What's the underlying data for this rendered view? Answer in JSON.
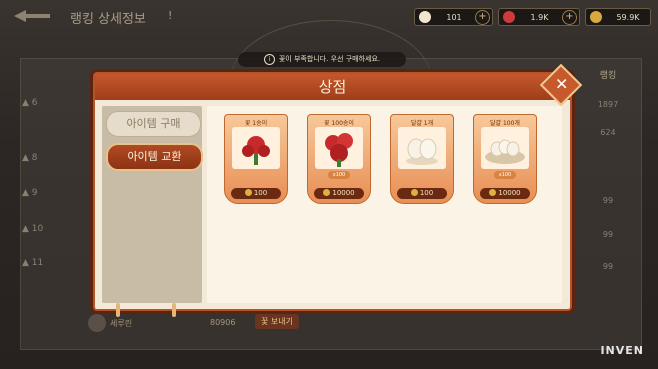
{
  "page": {
    "title": "랭킹 상세정보",
    "info_icon": "!"
  },
  "resources": [
    {
      "name": "egg",
      "value": "101",
      "color": "#f2e6cf"
    },
    {
      "name": "flower",
      "value": "1.9K",
      "color": "#d03a3a"
    },
    {
      "name": "gold",
      "value": "59.9K",
      "color": "#d9a840"
    }
  ],
  "notice": "꽃이 부족합니다. 우선 구매하세요.",
  "modal": {
    "title": "상점",
    "close_icon": "close-icon"
  },
  "tabs": [
    {
      "label": "아이템 구매",
      "active": false
    },
    {
      "label": "아이템 교환",
      "active": true
    }
  ],
  "items": [
    {
      "name": "꽃 1송이",
      "price": "100",
      "tag": "",
      "icon": "flower-icon"
    },
    {
      "name": "꽃 100송이",
      "price": "10000",
      "tag": "x100",
      "icon": "flower-bouquet-icon"
    },
    {
      "name": "달걀 1개",
      "price": "100",
      "tag": "",
      "icon": "egg-icon"
    },
    {
      "name": "달걀 100개",
      "price": "10000",
      "tag": "x100",
      "icon": "egg-basket-icon"
    }
  ],
  "background": {
    "ranks": [
      "6",
      "8",
      "9",
      "10",
      "11"
    ],
    "right_header": "랭킹",
    "right_values": [
      "1897",
      "624",
      "99",
      "99",
      "99"
    ],
    "player_name": "세루린",
    "player_score": "80906",
    "send_button": "꽃 보내기"
  },
  "watermark": "INVEN"
}
